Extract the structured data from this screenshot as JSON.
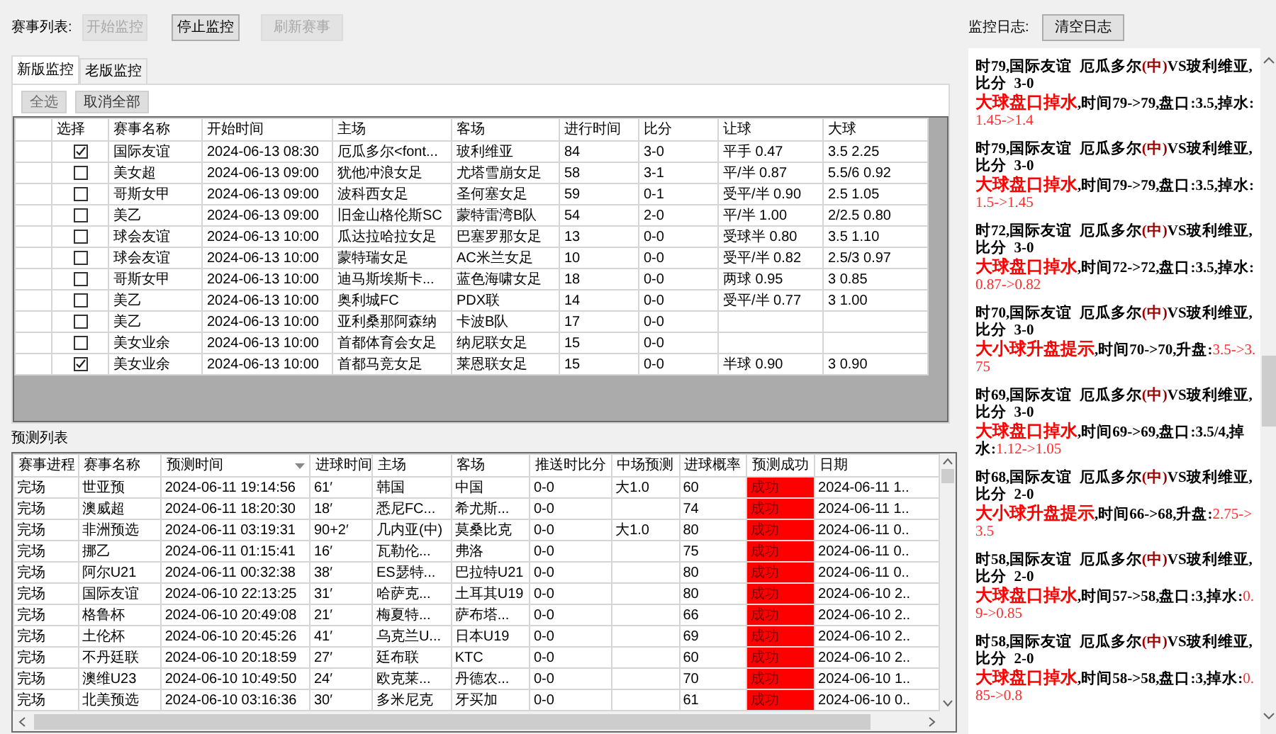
{
  "toolbar": {
    "label": "赛事列表:",
    "buttons": [
      {
        "label": "开始监控",
        "disabled": true
      },
      {
        "label": "停止监控",
        "disabled": false
      },
      {
        "label": "刷新赛事",
        "disabled": true
      }
    ]
  },
  "tabs": [
    {
      "label": "新版监控",
      "selected": true
    },
    {
      "label": "老版监控",
      "selected": false
    }
  ],
  "select_buttons": [
    "全选",
    "取消全部"
  ],
  "matches": {
    "columns": [
      "选择",
      "赛事名称",
      "开始时间",
      "主场",
      "客场",
      "进行时间",
      "比分",
      "让球",
      "大球"
    ],
    "rows": [
      {
        "checked": true,
        "league": "国际友谊",
        "start": "2024-06-13 08:30",
        "home": "厄瓜多尔<font...",
        "away": "玻利维亚",
        "elapsed": "84",
        "score": "3-0",
        "handicap": "平手 0.47",
        "over": "3.5 2.25"
      },
      {
        "checked": false,
        "league": "美女超",
        "start": "2024-06-13 09:00",
        "home": "犹他冲浪女足",
        "away": "尤塔雪崩女足",
        "elapsed": "58",
        "score": "3-1",
        "handicap": "平/半 0.87",
        "over": "5.5/6 0.92"
      },
      {
        "checked": false,
        "league": "哥斯女甲",
        "start": "2024-06-13 09:00",
        "home": "波科西女足",
        "away": "圣何塞女足",
        "elapsed": "59",
        "score": "0-1",
        "handicap": "受平/半 0.90",
        "over": "2.5 1.05"
      },
      {
        "checked": false,
        "league": "美乙",
        "start": "2024-06-13 09:00",
        "home": "旧金山格伦斯SC",
        "away": "蒙特雷湾B队",
        "elapsed": "54",
        "score": "2-0",
        "handicap": "平/半 1.00",
        "over": "2/2.5 0.80"
      },
      {
        "checked": false,
        "league": "球会友谊",
        "start": "2024-06-13 10:00",
        "home": "瓜达拉哈拉女足",
        "away": "巴塞罗那女足",
        "elapsed": "13",
        "score": "0-0",
        "handicap": "受球半 0.80",
        "over": "3.5 1.10"
      },
      {
        "checked": false,
        "league": "球会友谊",
        "start": "2024-06-13 10:00",
        "home": "蒙特瑞女足",
        "away": "AC米兰女足",
        "elapsed": "10",
        "score": "0-0",
        "handicap": "受平/半 0.82",
        "over": "2.5/3 0.97"
      },
      {
        "checked": false,
        "league": "哥斯女甲",
        "start": "2024-06-13 10:00",
        "home": "迪马斯埃斯卡...",
        "away": "蓝色海啸女足",
        "elapsed": "18",
        "score": "0-0",
        "handicap": "两球 0.95",
        "over": "3 0.85"
      },
      {
        "checked": false,
        "league": "美乙",
        "start": "2024-06-13 10:00",
        "home": "奥利城FC",
        "away": "PDX联",
        "elapsed": "14",
        "score": "0-0",
        "handicap": "受平/半 0.77",
        "over": "3 1.00"
      },
      {
        "checked": false,
        "league": "美乙",
        "start": "2024-06-13 10:00",
        "home": "亚利桑那阿森纳",
        "away": "卡波B队",
        "elapsed": "17",
        "score": "0-0"
      },
      {
        "checked": false,
        "league": "美女业余",
        "start": "2024-06-13 10:00",
        "home": "首都体育会女足",
        "away": "纳尼联女足",
        "elapsed": "15",
        "score": "0-0"
      },
      {
        "checked": true,
        "league": "美女业余",
        "start": "2024-06-13 10:00",
        "home": "首都马竞女足",
        "away": "莱恩联女足",
        "elapsed": "15",
        "score": "0-0",
        "handicap": "半球 0.90",
        "over": "3 0.90"
      }
    ]
  },
  "predictions": {
    "title": "预测列表",
    "columns": [
      "赛事进程",
      "赛事名称",
      "预测时间",
      "进球时间",
      "主场",
      "客场",
      "推送时比分",
      "中场预测",
      "进球概率",
      "预测成功",
      "日期"
    ],
    "rows": [
      {
        "progress": "完场",
        "league": "世亚预",
        "time": "2024-06-11 19:14:56",
        "goal": "61′",
        "home": "韩国",
        "away": "中国",
        "push_score": "0-0",
        "half": "大1.0",
        "prob": "60",
        "result": "成功",
        "success": true,
        "date": "2024-06-11 1.."
      },
      {
        "progress": "完场",
        "league": "澳威超",
        "time": "2024-06-11 18:20:30",
        "goal": "18′",
        "home": "悉尼FC...",
        "away": "希尤斯...",
        "push_score": "0-0",
        "prob": "74",
        "result": "成功",
        "success": true,
        "date": "2024-06-11 1.."
      },
      {
        "progress": "完场",
        "league": "非洲预选",
        "time": "2024-06-11 03:19:31",
        "goal": "90+2′",
        "home": "几内亚(中)",
        "away": "莫桑比克",
        "push_score": "0-0",
        "half": "大1.0",
        "prob": "80",
        "result": "成功",
        "success": true,
        "date": "2024-06-11 0.."
      },
      {
        "progress": "完场",
        "league": "挪乙",
        "time": "2024-06-11 01:15:41",
        "goal": "16′",
        "home": "瓦勒伦...",
        "away": "弗洛",
        "push_score": "0-0",
        "prob": "75",
        "result": "成功",
        "success": true,
        "date": "2024-06-11 0.."
      },
      {
        "progress": "完场",
        "league": "阿尔U21",
        "time": "2024-06-11 00:32:38",
        "goal": "38′",
        "home": "ES瑟特...",
        "away": "巴拉特U21",
        "push_score": "0-0",
        "prob": "80",
        "result": "成功",
        "success": true,
        "date": "2024-06-11 0.."
      },
      {
        "progress": "完场",
        "league": "国际友谊",
        "time": "2024-06-10 22:13:25",
        "goal": "31′",
        "home": "哈萨克...",
        "away": "土耳其U19",
        "push_score": "0-0",
        "prob": "80",
        "result": "成功",
        "success": true,
        "date": "2024-06-10 2.."
      },
      {
        "progress": "完场",
        "league": "格鲁杯",
        "time": "2024-06-10 20:49:08",
        "goal": "21′",
        "home": "梅夏特...",
        "away": "萨布塔...",
        "push_score": "0-0",
        "prob": "66",
        "result": "成功",
        "success": true,
        "date": "2024-06-10 2.."
      },
      {
        "progress": "完场",
        "league": "土伦杯",
        "time": "2024-06-10 20:45:26",
        "goal": "41′",
        "home": "乌克兰U...",
        "away": "日本U19",
        "push_score": "0-0",
        "prob": "69",
        "result": "成功",
        "success": true,
        "date": "2024-06-10 2.."
      },
      {
        "progress": "完场",
        "league": "不丹廷联",
        "time": "2024-06-10 20:18:59",
        "goal": "27′",
        "home": "廷布联",
        "away": "KTC",
        "push_score": "0-0",
        "prob": "60",
        "result": "成功",
        "success": true,
        "date": "2024-06-10 2.."
      },
      {
        "progress": "完场",
        "league": "澳维U23",
        "time": "2024-06-10 10:49:50",
        "goal": "24′",
        "home": "欧克莱...",
        "away": "丹德农...",
        "push_score": "0-0",
        "prob": "70",
        "result": "成功",
        "success": true,
        "date": "2024-06-10 1.."
      },
      {
        "progress": "完场",
        "league": "北美预选",
        "time": "2024-06-10 03:16:36",
        "goal": "30′",
        "home": "多米尼克",
        "away": "牙买加",
        "push_score": "0-0",
        "prob": "61",
        "result": "成功",
        "success": true,
        "date": "2024-06-10 0.."
      }
    ]
  },
  "log": {
    "label": "监控日志:",
    "clear_button": "清空日志",
    "entries": [
      {
        "heading": [
          {
            "kind": "text",
            "text": "时79,国际友谊  厄瓜多尔"
          },
          {
            "kind": "mark",
            "text": "(中)"
          },
          {
            "kind": "text",
            "text": "VS玻利维亚,比分  3-0"
          }
        ],
        "detail": [
          {
            "kind": "alert",
            "text": "大球盘口掉水"
          },
          {
            "kind": "text",
            "text": ",时间79->79,盘口:3.5,掉水:"
          },
          {
            "kind": "value",
            "text": "1.45->1.4"
          }
        ]
      },
      {
        "heading": [
          {
            "kind": "text",
            "text": "时79,国际友谊  厄瓜多尔"
          },
          {
            "kind": "mark",
            "text": "(中)"
          },
          {
            "kind": "text",
            "text": "VS玻利维亚,比分  3-0"
          }
        ],
        "detail": [
          {
            "kind": "alert",
            "text": "大球盘口掉水"
          },
          {
            "kind": "text",
            "text": ",时间79->79,盘口:3.5,掉水:"
          },
          {
            "kind": "value",
            "text": "1.5->1.45"
          }
        ]
      },
      {
        "heading": [
          {
            "kind": "text",
            "text": "时72,国际友谊  厄瓜多尔"
          },
          {
            "kind": "mark",
            "text": "(中)"
          },
          {
            "kind": "text",
            "text": "VS玻利维亚,比分  3-0"
          }
        ],
        "detail": [
          {
            "kind": "alert",
            "text": "大球盘口掉水"
          },
          {
            "kind": "text",
            "text": ",时间72->72,盘口:3.5,掉水:"
          },
          {
            "kind": "value",
            "text": "0.87->0.82"
          }
        ]
      },
      {
        "heading": [
          {
            "kind": "text",
            "text": "时70,国际友谊  厄瓜多尔"
          },
          {
            "kind": "mark",
            "text": "(中)"
          },
          {
            "kind": "text",
            "text": "VS玻利维亚,比分  3-0"
          }
        ],
        "detail": [
          {
            "kind": "alert",
            "text": "大小球升盘提示"
          },
          {
            "kind": "text",
            "text": ",时间70->70,升盘:"
          },
          {
            "kind": "value",
            "text": "3.5->3.75"
          }
        ]
      },
      {
        "heading": [
          {
            "kind": "text",
            "text": "时69,国际友谊  厄瓜多尔"
          },
          {
            "kind": "mark",
            "text": "(中)"
          },
          {
            "kind": "text",
            "text": "VS玻利维亚,比分  3-0"
          }
        ],
        "detail": [
          {
            "kind": "alert",
            "text": "大球盘口掉水"
          },
          {
            "kind": "text",
            "text": ",时间69->69,盘口:3.5/4,掉水:"
          },
          {
            "kind": "value",
            "text": "1.12->1.05"
          }
        ]
      },
      {
        "heading": [
          {
            "kind": "text",
            "text": "时68,国际友谊  厄瓜多尔"
          },
          {
            "kind": "mark",
            "text": "(中)"
          },
          {
            "kind": "text",
            "text": "VS玻利维亚,比分  2-0"
          }
        ],
        "detail": [
          {
            "kind": "alert",
            "text": "大小球升盘提示"
          },
          {
            "kind": "text",
            "text": ",时间66->68,升盘:"
          },
          {
            "kind": "value",
            "text": "2.75->3.5"
          }
        ]
      },
      {
        "heading": [
          {
            "kind": "text",
            "text": "时58,国际友谊  厄瓜多尔"
          },
          {
            "kind": "mark",
            "text": "(中)"
          },
          {
            "kind": "text",
            "text": "VS玻利维亚,比分  2-0"
          }
        ],
        "detail": [
          {
            "kind": "alert",
            "text": "大球盘口掉水"
          },
          {
            "kind": "text",
            "text": ",时间57->58,盘口:3,掉水:"
          },
          {
            "kind": "value",
            "text": "0.9->0.85"
          }
        ]
      },
      {
        "heading": [
          {
            "kind": "text",
            "text": "时58,国际友谊  厄瓜多尔"
          },
          {
            "kind": "mark",
            "text": "(中)"
          },
          {
            "kind": "text",
            "text": "VS玻利维亚,比分  2-0"
          }
        ],
        "detail": [
          {
            "kind": "alert",
            "text": "大球盘口掉水"
          },
          {
            "kind": "text",
            "text": ",时间58->58,盘口:3,掉水:"
          },
          {
            "kind": "value",
            "text": "0.85->0.8"
          }
        ]
      }
    ]
  }
}
